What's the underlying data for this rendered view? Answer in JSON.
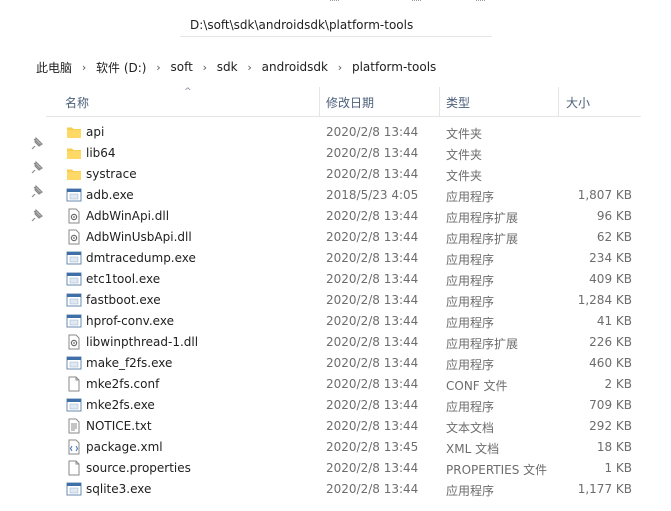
{
  "address": {
    "path": "D:\\soft\\sdk\\androidsdk\\platform-tools"
  },
  "breadcrumb": [
    "此电脑",
    "软件 (D:)",
    "soft",
    "sdk",
    "androidsdk",
    "platform-tools"
  ],
  "columns": {
    "name": "名称",
    "date": "修改日期",
    "type": "类型",
    "size": "大小"
  },
  "files": [
    {
      "name": "api",
      "date": "2020/2/8 13:44",
      "type": "文件夹",
      "size": "",
      "icon": "folder-icon"
    },
    {
      "name": "lib64",
      "date": "2020/2/8 13:44",
      "type": "文件夹",
      "size": "",
      "icon": "folder-icon"
    },
    {
      "name": "systrace",
      "date": "2020/2/8 13:44",
      "type": "文件夹",
      "size": "",
      "icon": "folder-icon"
    },
    {
      "name": "adb.exe",
      "date": "2018/5/23 4:05",
      "type": "应用程序",
      "size": "1,807 KB",
      "icon": "exe-icon"
    },
    {
      "name": "AdbWinApi.dll",
      "date": "2020/2/8 13:44",
      "type": "应用程序扩展",
      "size": "96 KB",
      "icon": "dll-icon"
    },
    {
      "name": "AdbWinUsbApi.dll",
      "date": "2020/2/8 13:44",
      "type": "应用程序扩展",
      "size": "62 KB",
      "icon": "dll-icon"
    },
    {
      "name": "dmtracedump.exe",
      "date": "2020/2/8 13:44",
      "type": "应用程序",
      "size": "234 KB",
      "icon": "exe-icon"
    },
    {
      "name": "etc1tool.exe",
      "date": "2020/2/8 13:44",
      "type": "应用程序",
      "size": "409 KB",
      "icon": "exe-icon"
    },
    {
      "name": "fastboot.exe",
      "date": "2020/2/8 13:44",
      "type": "应用程序",
      "size": "1,284 KB",
      "icon": "exe-icon"
    },
    {
      "name": "hprof-conv.exe",
      "date": "2020/2/8 13:44",
      "type": "应用程序",
      "size": "41 KB",
      "icon": "exe-icon"
    },
    {
      "name": "libwinpthread-1.dll",
      "date": "2020/2/8 13:44",
      "type": "应用程序扩展",
      "size": "226 KB",
      "icon": "dll-icon"
    },
    {
      "name": "make_f2fs.exe",
      "date": "2020/2/8 13:44",
      "type": "应用程序",
      "size": "460 KB",
      "icon": "exe-icon"
    },
    {
      "name": "mke2fs.conf",
      "date": "2020/2/8 13:44",
      "type": "CONF 文件",
      "size": "2 KB",
      "icon": "file-icon"
    },
    {
      "name": "mke2fs.exe",
      "date": "2020/2/8 13:44",
      "type": "应用程序",
      "size": "709 KB",
      "icon": "exe-icon"
    },
    {
      "name": "NOTICE.txt",
      "date": "2020/2/8 13:44",
      "type": "文本文档",
      "size": "292 KB",
      "icon": "txt-icon"
    },
    {
      "name": "package.xml",
      "date": "2020/2/8 13:45",
      "type": "XML 文档",
      "size": "18 KB",
      "icon": "xml-icon"
    },
    {
      "name": "source.properties",
      "date": "2020/2/8 13:44",
      "type": "PROPERTIES 文件",
      "size": "1 KB",
      "icon": "file-icon"
    },
    {
      "name": "sqlite3.exe",
      "date": "2020/2/8 13:44",
      "type": "应用程序",
      "size": "1,177 KB",
      "icon": "exe-icon"
    }
  ]
}
